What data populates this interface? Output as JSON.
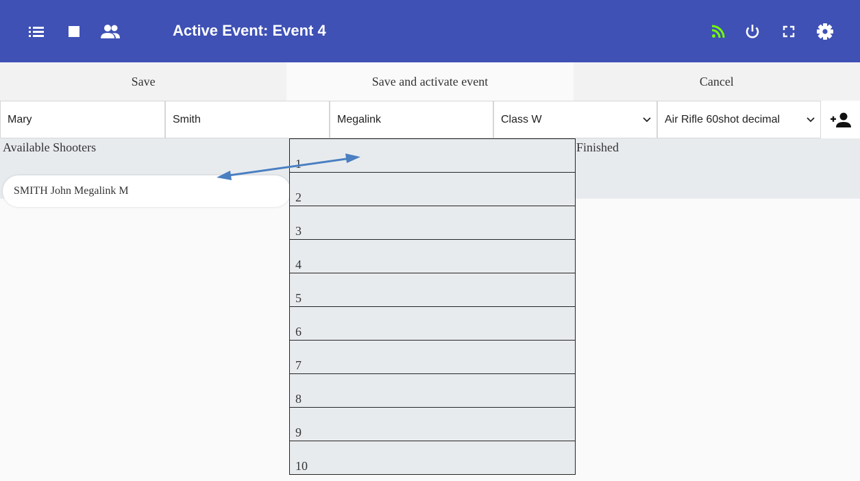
{
  "header": {
    "title": "Active Event: Event 4",
    "icons": [
      "list-icon",
      "stop-icon",
      "group-icon",
      "rss-icon",
      "power-icon",
      "fullscreen-icon",
      "gear-icon"
    ],
    "rss_color": "#76ff03",
    "bar_color": "#3f51b5"
  },
  "actions": {
    "save": "Save",
    "save_activate": "Save and activate event",
    "cancel": "Cancel"
  },
  "form": {
    "first_name": "Mary",
    "last_name": "Smith",
    "club": "Megalink",
    "class": "Class W",
    "discipline": "Air Rifle 60shot decimal"
  },
  "available": {
    "title": "Available Shooters",
    "shooters": [
      "SMITH John Megalink M"
    ]
  },
  "finished": {
    "title": "Finished"
  },
  "lanes": [
    "1",
    "2",
    "3",
    "4",
    "5",
    "6",
    "7",
    "8",
    "9",
    "10"
  ]
}
